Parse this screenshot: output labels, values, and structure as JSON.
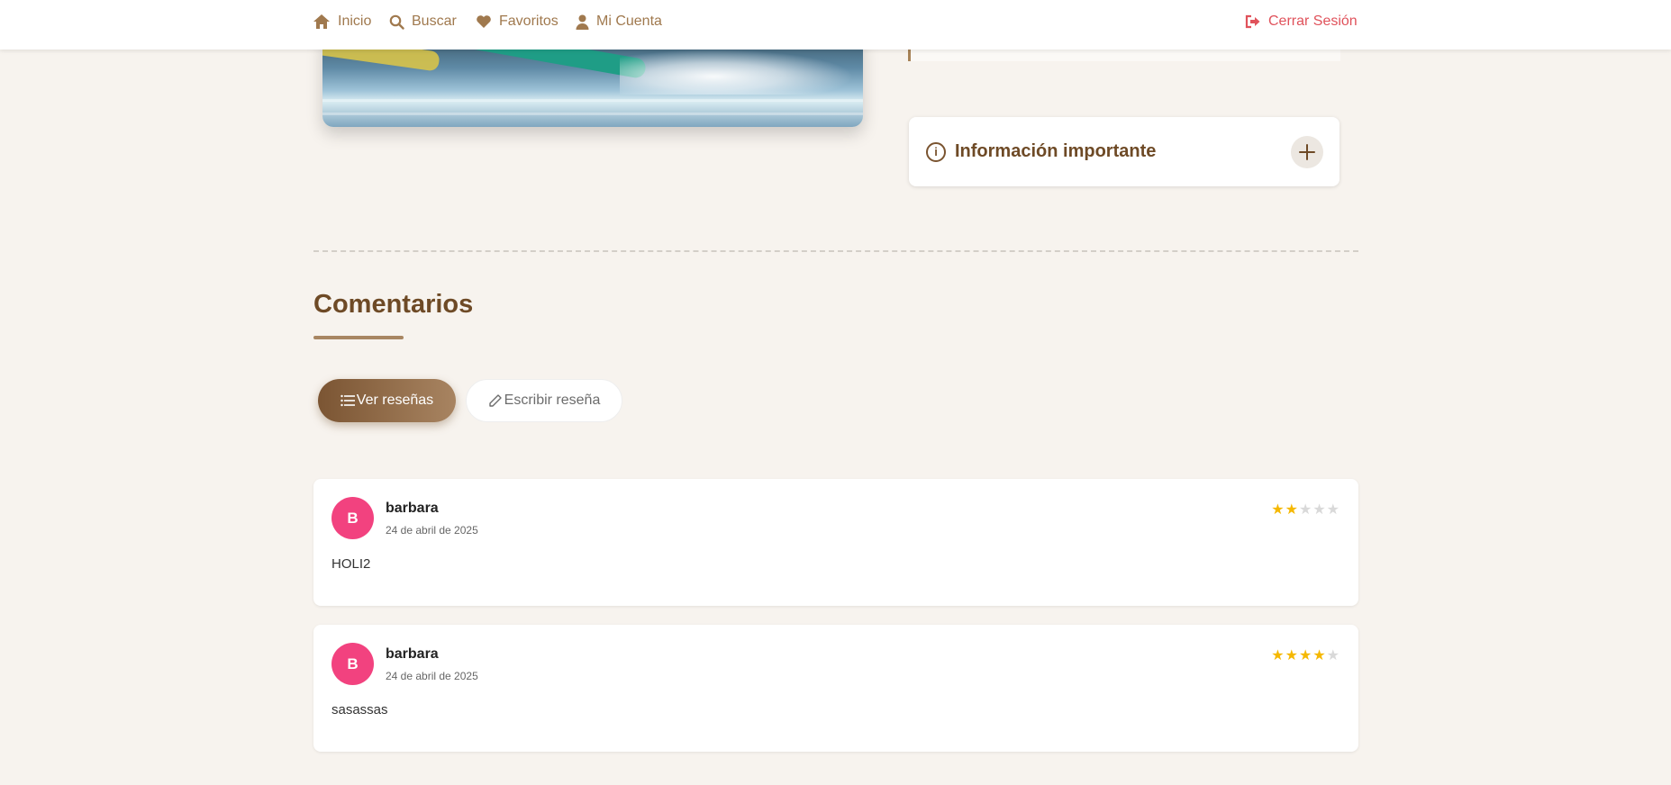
{
  "nav": {
    "home": "Inicio",
    "search": "Buscar",
    "favorites": "Favoritos",
    "account": "Mi Cuenta",
    "logout": "Cerrar Sesión"
  },
  "info_card": {
    "title": "Información importante"
  },
  "comments": {
    "title": "Comentarios",
    "view_label": "Ver reseñas",
    "write_label": "Escribir reseña"
  },
  "reviews": [
    {
      "initial": "B",
      "name": "barbara",
      "date": "24 de abril de 2025",
      "text": "HOLI2",
      "rating": 2,
      "max": 5
    },
    {
      "initial": "B",
      "name": "barbara",
      "date": "24 de abril de 2025",
      "text": "sasassas",
      "rating": 4,
      "max": 5
    }
  ],
  "colors": {
    "accent": "#6e4a26",
    "brand": "#a0794e",
    "logout": "#e0525b",
    "avatar": "#f2427f",
    "star": "#f5b800"
  },
  "icons": {
    "home": "home-icon",
    "search": "search-icon",
    "heart": "heart-icon",
    "user": "user-icon",
    "logout": "logout-icon",
    "info": "info-icon",
    "plus": "plus-icon",
    "list": "list-icon",
    "pencil": "pencil-icon"
  }
}
